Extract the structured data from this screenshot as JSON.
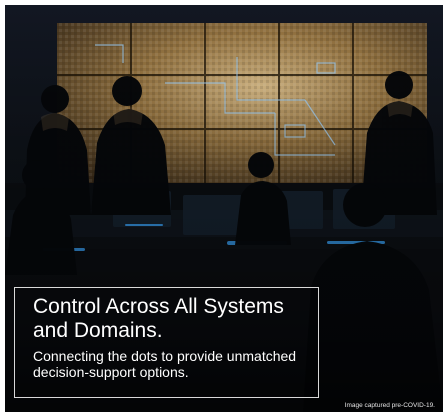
{
  "headline": "Control Across All Systems and Domains.",
  "subline": "Connecting the dots to provide unmatched decision-support options.",
  "footnote": "Image captured pre-COVID-19.",
  "colors": {
    "background": "#0b0f13",
    "screen_glow": "#b89a64",
    "screen_lines": "#9fd3ff",
    "monitor_blue": "#3aa7ff",
    "text": "#ffffff"
  }
}
